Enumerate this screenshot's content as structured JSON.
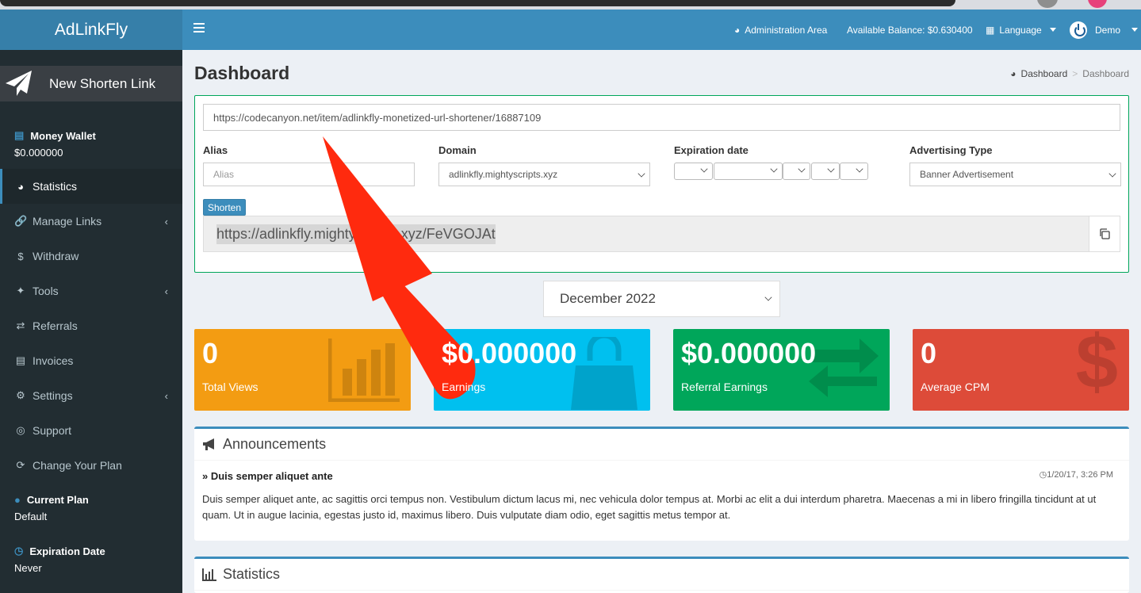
{
  "app": {
    "brand": "AdLinkFly"
  },
  "topnav": {
    "admin_area": "Administration Area",
    "balance": "Available Balance: $0.630400",
    "language": "Language",
    "user": "Demo"
  },
  "sidebar": {
    "new_link": "New Shorten Link",
    "wallet": {
      "label": "Money Wallet",
      "value": "$0.000000"
    },
    "items": [
      {
        "label": "Statistics"
      },
      {
        "label": "Manage Links"
      },
      {
        "label": "Withdraw"
      },
      {
        "label": "Tools"
      },
      {
        "label": "Referrals"
      },
      {
        "label": "Invoices"
      },
      {
        "label": "Settings"
      },
      {
        "label": "Support"
      },
      {
        "label": "Change Your Plan"
      }
    ],
    "plan": {
      "label": "Current Plan",
      "value": "Default"
    },
    "expiration": {
      "label": "Expiration Date",
      "value": "Never"
    }
  },
  "page": {
    "title": "Dashboard",
    "breadcrumb": [
      "Dashboard",
      ">",
      "Dashboard"
    ]
  },
  "shorten": {
    "url": "https://codecanyon.net/item/adlinkfly-monetized-url-shortener/16887109",
    "alias_label": "Alias",
    "alias_placeholder": "Alias",
    "domain_label": "Domain",
    "domain_value": "adlinkfly.mightyscripts.xyz",
    "expiration_label": "Expiration date",
    "ad_type_label": "Advertising Type",
    "ad_type_value": "Banner Advertisement",
    "button": "Shorten",
    "result": "https://adlinkfly.mightyscripts.xyz/FeVGOJAt"
  },
  "month_select": "December 2022",
  "stats": [
    {
      "value": "0",
      "label": "Total Views",
      "color": "#f39c12"
    },
    {
      "value": "$0.000000",
      "label": "Earnings",
      "color": "#00c0ef"
    },
    {
      "value": "$0.000000",
      "label": "Referral Earnings",
      "color": "#00a65a"
    },
    {
      "value": "0",
      "label": "Average CPM",
      "color": "#dd4b39"
    }
  ],
  "announcements": {
    "title": "Announcements",
    "item_title": "Duis semper aliquet ante",
    "date": "1/20/17, 3:26 PM",
    "body": "Duis semper aliquet ante, ac sagittis orci tempus non. Vestibulum dictum lacus mi, nec vehicula dolor tempus at. Morbi ac elit a dui interdum pharetra. Maecenas a mi in libero fringilla tincidunt at ut quam. Ut in augue lacinia, egestas justo id, maximus libero. Duis vulputate diam odio, eget sagittis metus tempor at."
  },
  "statistics_box": {
    "title": "Statistics"
  },
  "annotation": {
    "arrow_color": "#ff2a0e"
  }
}
